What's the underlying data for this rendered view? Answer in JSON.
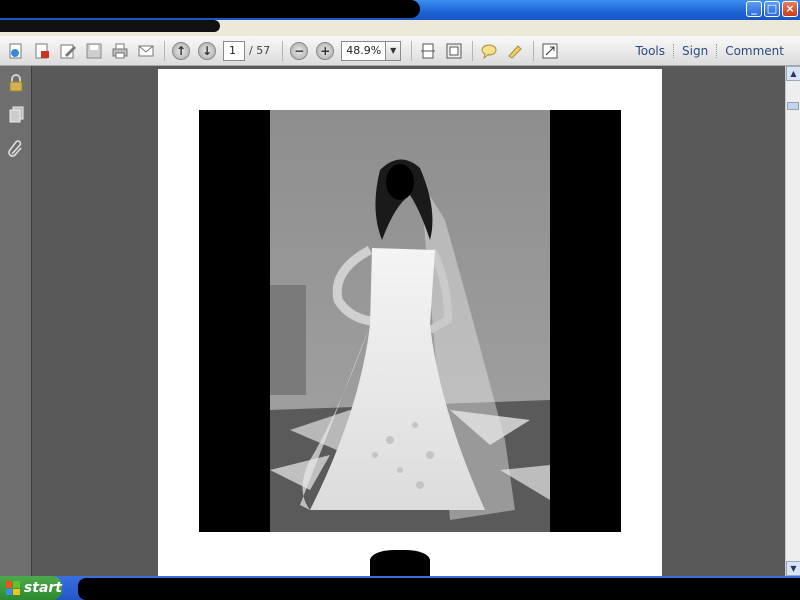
{
  "toolbar": {
    "page_current": "1",
    "page_separator": "/",
    "page_total": "57",
    "zoom": "48.9%",
    "links": [
      "Tools",
      "Sign",
      "Comment"
    ]
  },
  "window": {
    "minimize": "_",
    "maximize": "□",
    "close": "×"
  },
  "taskbar": {
    "start_label": "start"
  },
  "icons": {
    "toolbar": [
      "create-pdf-icon",
      "convert-icon",
      "edit-icon",
      "save-icon",
      "print-icon",
      "email-icon",
      "prev-page-icon",
      "next-page-icon",
      "zoom-out-icon",
      "zoom-in-icon",
      "fit-page-icon",
      "fit-width-icon",
      "comment-icon",
      "highlight-icon",
      "fullscreen-icon"
    ],
    "sidebar": [
      "lock-icon",
      "pages-icon",
      "attachment-icon"
    ]
  },
  "colors": {
    "titlebar": "#1d64d6",
    "start": "#2f8a2f",
    "link": "#2c4c7c"
  }
}
